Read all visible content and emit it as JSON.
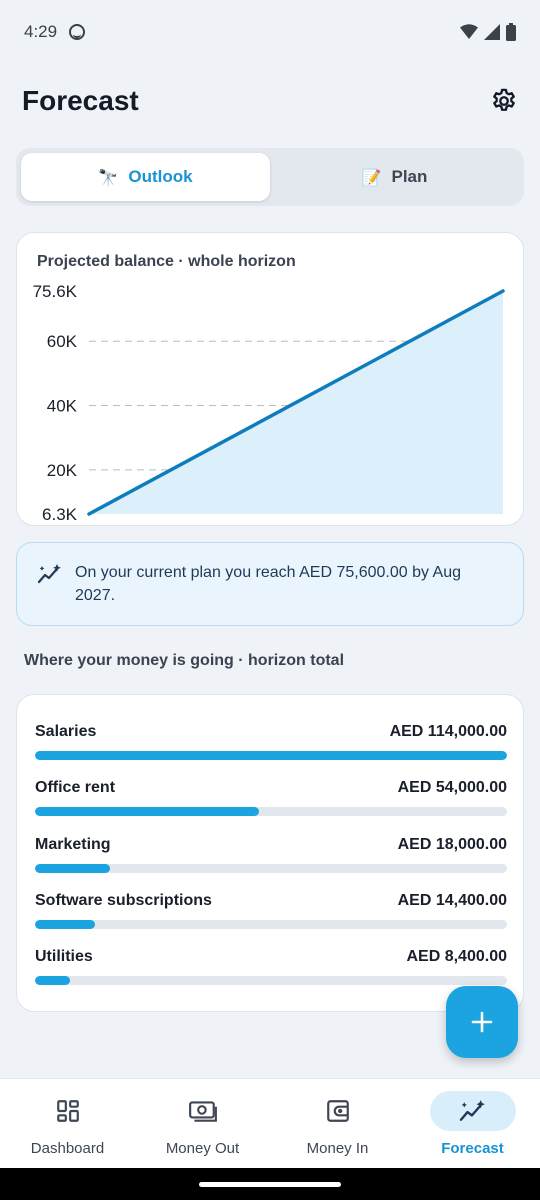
{
  "status_bar": {
    "time": "4:29"
  },
  "header": {
    "title": "Forecast"
  },
  "tabs": [
    {
      "label": "Outlook",
      "emoji": "🔭",
      "active": true
    },
    {
      "label": "Plan",
      "emoji": "📝",
      "active": false
    }
  ],
  "chart": {
    "title": "Projected balance · whole horizon"
  },
  "chart_data": {
    "type": "area",
    "title": "Projected balance · whole horizon",
    "xlabel": "",
    "ylabel": "",
    "x": [
      0,
      1
    ],
    "series": [
      {
        "values": [
          6300,
          75600
        ]
      }
    ],
    "ylim": [
      6300,
      75600
    ],
    "y_ticks": [
      6300,
      20000,
      40000,
      60000,
      75600
    ],
    "y_tick_labels": [
      "6.3K",
      "20K",
      "40K",
      "60K",
      "75.6K"
    ],
    "grid": true,
    "line_color": "#0f7dbd",
    "fill_color": "#dcf0fb"
  },
  "insight": {
    "text": "On your current plan you reach AED 75,600.00 by Aug 2027."
  },
  "breakdown": {
    "heading": "Where your money is going · horizon total",
    "items": [
      {
        "name": "Salaries",
        "amount": "AED 114,000.00",
        "value": 114000
      },
      {
        "name": "Office rent",
        "amount": "AED 54,000.00",
        "value": 54000
      },
      {
        "name": "Marketing",
        "amount": "AED 18,000.00",
        "value": 18000
      },
      {
        "name": "Software subscriptions",
        "amount": "AED 14,400.00",
        "value": 14400
      },
      {
        "name": "Utilities",
        "amount": "AED 8,400.00",
        "value": 8400
      }
    ]
  },
  "fab": {
    "icon": "plus-icon"
  },
  "nav": [
    {
      "label": "Dashboard",
      "icon": "dashboard-icon",
      "active": false
    },
    {
      "label": "Money Out",
      "icon": "money-out-icon",
      "active": false
    },
    {
      "label": "Money In",
      "icon": "money-in-icon",
      "active": false
    },
    {
      "label": "Forecast",
      "icon": "forecast-icon",
      "active": true
    }
  ],
  "colors": {
    "accent": "#1ba4e0",
    "accent_text": "#1993d3",
    "background": "#eff3f8"
  }
}
